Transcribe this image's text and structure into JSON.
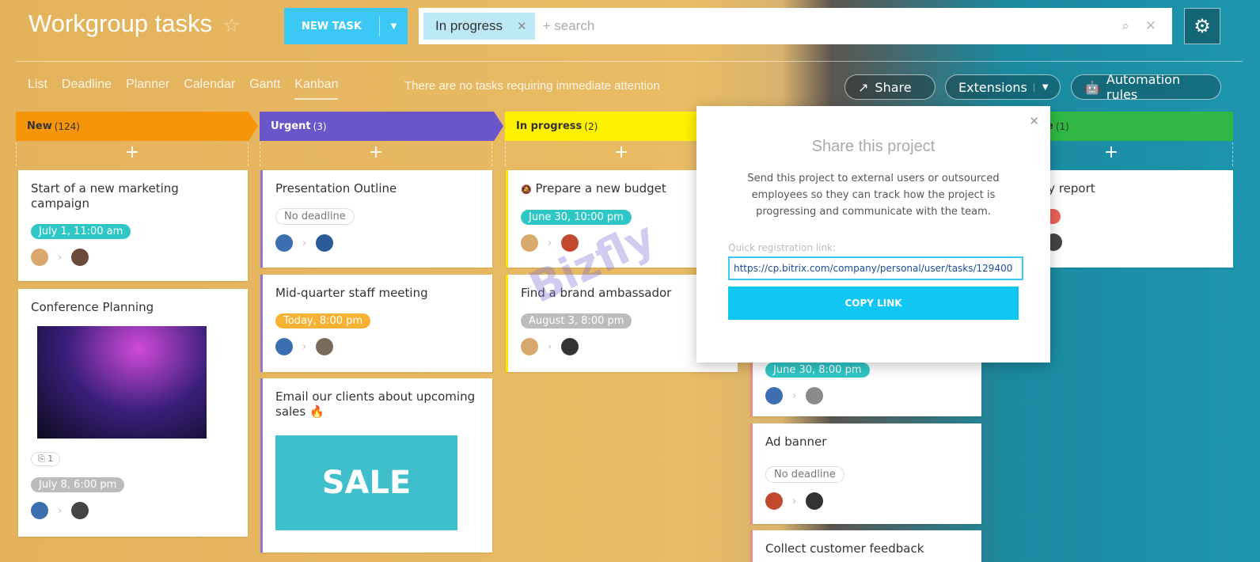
{
  "header": {
    "title": "Workgroup tasks",
    "new_task": "NEW TASK",
    "filter_chip": "In progress",
    "search_placeholder": "+ search"
  },
  "tabs": [
    "List",
    "Deadline",
    "Planner",
    "Calendar",
    "Gantt",
    "Kanban"
  ],
  "active_tab": "Kanban",
  "notice": "There are no tasks requiring immediate attention",
  "actions": {
    "share": "Share",
    "extensions": "Extensions",
    "automation": "Automation rules"
  },
  "columns": [
    {
      "title": "New",
      "count": "(124)",
      "color": "#f7950a"
    },
    {
      "title": "Urgent",
      "count": "(3)",
      "color": "#6a55c9"
    },
    {
      "title": "In progress",
      "count": "(2)",
      "color": "#fff200"
    },
    {
      "title": "e",
      "count": "(1)",
      "color": "#2fb843"
    }
  ],
  "cards": {
    "c1": {
      "title": "Start of a new marketing campaign",
      "deadline": "July 1, 11:00 am"
    },
    "c2": {
      "title": "Conference Planning",
      "attach": "1",
      "deadline": "July 8, 6:00 pm"
    },
    "c3": {
      "title": "Presentation Outline",
      "deadline": "No deadline"
    },
    "c4": {
      "title": "Mid-quarter staff meeting",
      "deadline": "Today, 8:00 pm"
    },
    "c5": {
      "title": "Email our clients about upcoming sales 🔥",
      "image_text": "SALE"
    },
    "c6": {
      "title": "Prepare a new budget",
      "deadline": "June 30, 10:00 pm"
    },
    "c7": {
      "title": "Find a brand ambassador",
      "deadline": "August 3, 8:00 pm"
    },
    "c8": {
      "deadline": "June 30, 8:00 pm"
    },
    "c9": {
      "title": "Ad banner",
      "deadline": "No deadline"
    },
    "c10": {
      "title": "Collect customer feedback"
    },
    "c11": {
      "title": "ly report"
    }
  },
  "popup": {
    "title": "Share this project",
    "text": "Send this project to external users or outsourced employees so they can track how the project is progressing and communicate with the team.",
    "link_label": "Quick registration link:",
    "link": "https://cp.bitrix.com/company/personal/user/tasks/129400",
    "copy": "COPY LINK"
  },
  "watermark": "Bizfly"
}
